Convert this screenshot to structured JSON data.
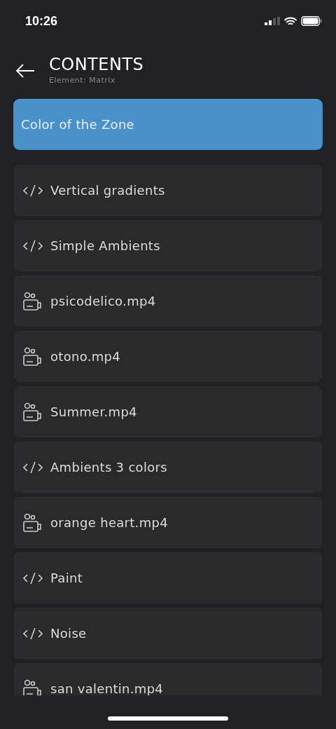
{
  "status_bar": {
    "time": "10:26"
  },
  "header": {
    "title": "CONTENTS",
    "subtitle": "Element: Matrix"
  },
  "current_zone": {
    "label": "Color of the Zone"
  },
  "items": [
    {
      "kind": "script",
      "label": "Vertical gradients"
    },
    {
      "kind": "script",
      "label": "Simple Ambients"
    },
    {
      "kind": "video",
      "label": "psicodelico.mp4"
    },
    {
      "kind": "video",
      "label": "otono.mp4"
    },
    {
      "kind": "video",
      "label": "Summer.mp4"
    },
    {
      "kind": "script",
      "label": "Ambients 3 colors"
    },
    {
      "kind": "video",
      "label": "orange heart.mp4"
    },
    {
      "kind": "script",
      "label": "Paint"
    },
    {
      "kind": "script",
      "label": "Noise"
    },
    {
      "kind": "video",
      "label": "san valentin.mp4"
    }
  ]
}
